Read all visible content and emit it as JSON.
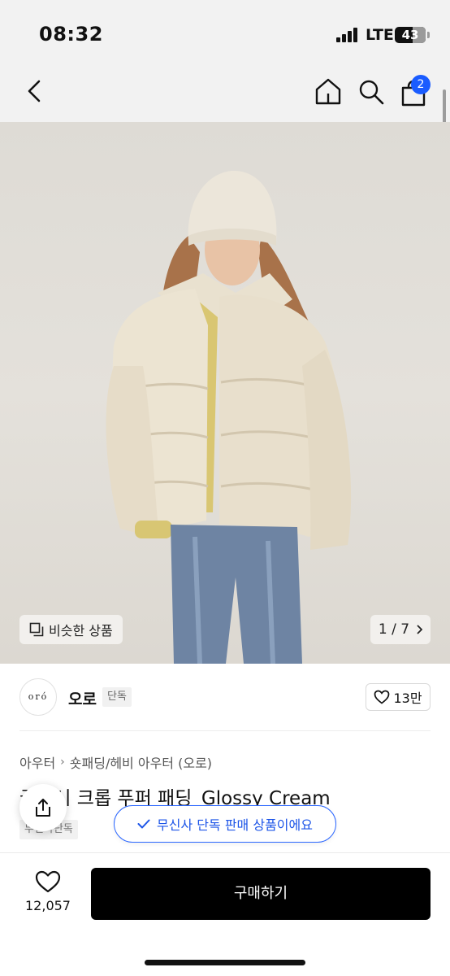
{
  "status_bar": {
    "time": "08:32",
    "network": "LTE",
    "battery": "43"
  },
  "nav": {
    "back_icon": "chevron-left-icon",
    "home_icon": "home-icon",
    "search_icon": "search-icon",
    "cart_icon": "shopping-bag-icon",
    "cart_count": "2"
  },
  "gallery": {
    "similar_label": "비슷한 상품",
    "counter": "1 / 7"
  },
  "brand": {
    "logo_text": "oró",
    "name": "오로",
    "tag": "단독",
    "like_count": "13만"
  },
  "product": {
    "breadcrumb": [
      "아우터",
      "숏패딩/헤비 아우터 (오로)"
    ],
    "title": "글로시 크롭 푸퍼 패딩_Glossy Cream",
    "exclusive_tag": "무신사단독"
  },
  "toast": {
    "text": "무신사 단독 판매 상품이에요"
  },
  "bottom_bar": {
    "wish_count": "12,057",
    "buy_label": "구매하기"
  },
  "colors": {
    "accent": "#1a5cff",
    "buy_button": "#000000"
  }
}
